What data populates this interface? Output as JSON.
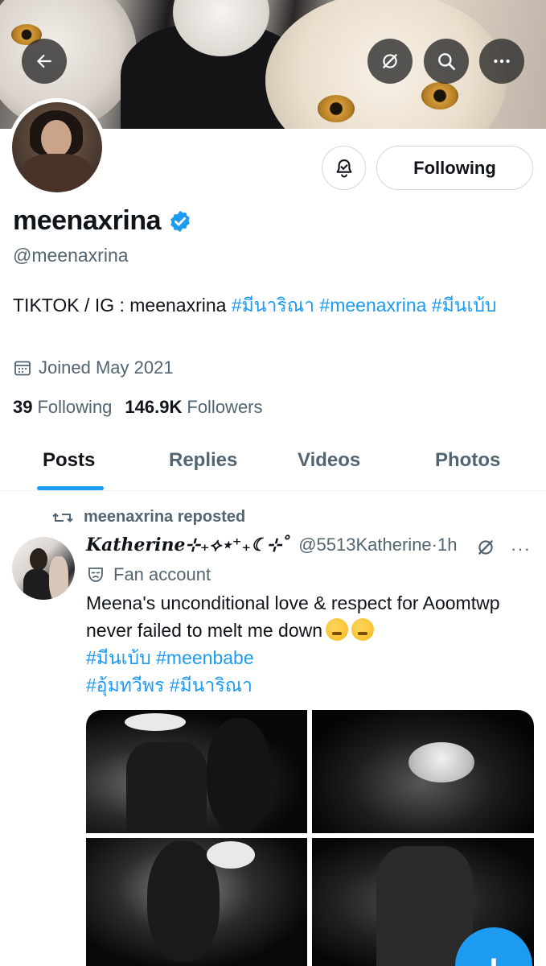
{
  "header": {
    "back_icon": "arrow-left-icon",
    "grok_icon": "grok-slash-icon",
    "search_icon": "search-icon",
    "more_icon": "more-horizontal-icon"
  },
  "profile": {
    "display_name": "meenaxrina",
    "handle": "@meenaxrina",
    "verified": true,
    "bio_text": "TIKTOK / IG : meenaxrina ",
    "bio_hashtags": "#มีนาริณา #meenaxrina #มีนเบ้บ",
    "joined": "Joined May 2021",
    "following_count": "39",
    "following_label": "Following",
    "followers_count": "146.9K",
    "followers_label": "Followers",
    "follow_button_label": "Following",
    "notify_icon": "bell-notification-icon"
  },
  "tabs": [
    {
      "label": "Posts",
      "active": true
    },
    {
      "label": "Replies",
      "active": false
    },
    {
      "label": "Videos",
      "active": false
    },
    {
      "label": "Photos",
      "active": false
    }
  ],
  "post": {
    "repost_label": "meenaxrina reposted",
    "author_name": "𝑲𝒂𝒕𝒉𝒆𝒓𝒊𝒏𝒆⊹₊⟡⋆⁺₊☾⊹˚",
    "author_handle": "@5513Katherine",
    "time": "·1h",
    "label": "Fan account",
    "text": "Meena's unconditional love & respect for Aoomtwp never failed to melt me down",
    "hashtags_line1": "#มีนเบ้บ #meenbabe",
    "hashtags_line2": "#อุ้มทวีพร #มีนาริณา",
    "emoji_count": 2,
    "media_count": 4
  },
  "fab": {
    "label": "+"
  },
  "colors": {
    "accent": "#1d9bf0",
    "text_primary": "#0f1419",
    "text_secondary": "#536471"
  }
}
